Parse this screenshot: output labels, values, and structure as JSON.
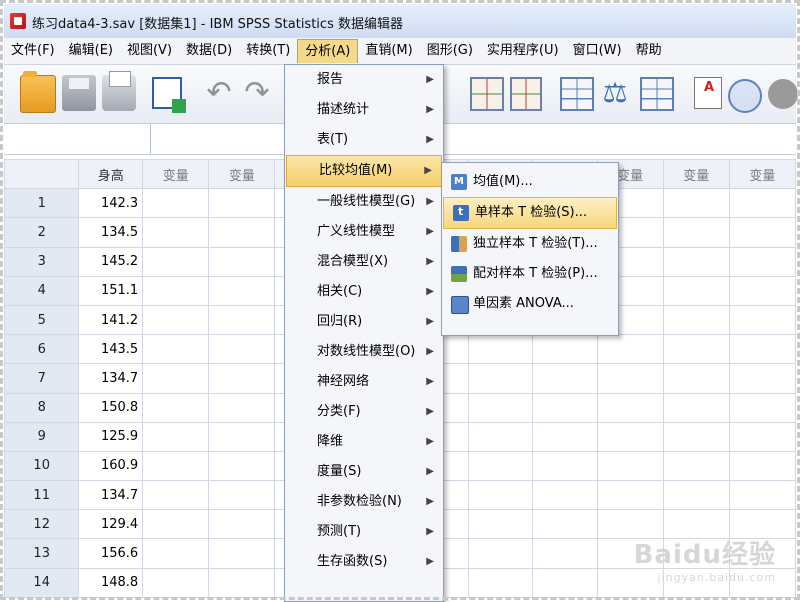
{
  "window": {
    "title": "练习data4-3.sav [数据集1] - IBM SPSS Statistics 数据编辑器"
  },
  "menubar": {
    "items": [
      {
        "label": "文件(F)"
      },
      {
        "label": "编辑(E)"
      },
      {
        "label": "视图(V)"
      },
      {
        "label": "数据(D)"
      },
      {
        "label": "转换(T)"
      },
      {
        "label": "分析(A)"
      },
      {
        "label": "直销(M)"
      },
      {
        "label": "图形(G)"
      },
      {
        "label": "实用程序(U)"
      },
      {
        "label": "窗口(W)"
      },
      {
        "label": "帮助"
      }
    ]
  },
  "toolbar": {
    "icons": [
      "open-folder-icon",
      "save-icon",
      "print-icon",
      "recall-dialog-icon",
      "undo-icon",
      "redo-icon",
      "goto-case-icon",
      "goto-variable-icon",
      "variables-icon",
      "weight-cases-icon",
      "split-file-icon",
      "value-labels-icon",
      "use-sets-icon",
      "show-all-variables-icon"
    ]
  },
  "grid": {
    "columns": [
      "身高",
      "变量",
      "变量",
      "",
      "",
      "",
      "",
      "",
      "变量",
      "变量",
      "变量"
    ],
    "rows": [
      {
        "num": "1",
        "height": "142.3"
      },
      {
        "num": "2",
        "height": "134.5"
      },
      {
        "num": "3",
        "height": "145.2"
      },
      {
        "num": "4",
        "height": "151.1"
      },
      {
        "num": "5",
        "height": "141.2"
      },
      {
        "num": "6",
        "height": "143.5"
      },
      {
        "num": "7",
        "height": "134.7"
      },
      {
        "num": "8",
        "height": "150.8"
      },
      {
        "num": "9",
        "height": "125.9"
      },
      {
        "num": "10",
        "height": "160.9"
      },
      {
        "num": "11",
        "height": "134.7"
      },
      {
        "num": "12",
        "height": "129.4"
      },
      {
        "num": "13",
        "height": "156.6"
      },
      {
        "num": "14",
        "height": "148.8"
      }
    ]
  },
  "analyze_menu": {
    "items": [
      {
        "label": "报告",
        "submenu": true
      },
      {
        "label": "描述统计",
        "submenu": true
      },
      {
        "label": "表(T)",
        "submenu": true
      },
      {
        "label": "比较均值(M)",
        "submenu": true,
        "highlighted": true
      },
      {
        "label": "一般线性模型(G)",
        "submenu": true
      },
      {
        "label": "广义线性模型",
        "submenu": true
      },
      {
        "label": "混合模型(X)",
        "submenu": true
      },
      {
        "label": "相关(C)",
        "submenu": true
      },
      {
        "label": "回归(R)",
        "submenu": true
      },
      {
        "label": "对数线性模型(O)",
        "submenu": true
      },
      {
        "label": "神经网络",
        "submenu": true
      },
      {
        "label": "分类(F)",
        "submenu": true
      },
      {
        "label": "降维",
        "submenu": true
      },
      {
        "label": "度量(S)",
        "submenu": true
      },
      {
        "label": "非参数检验(N)",
        "submenu": true
      },
      {
        "label": "预测(T)",
        "submenu": true
      },
      {
        "label": "生存函数(S)",
        "submenu": true
      }
    ]
  },
  "compare_means_menu": {
    "items": [
      {
        "label": "均值(M)...",
        "icon": "means-icon"
      },
      {
        "label": "单样本 T 检验(S)...",
        "icon": "one-sample-t-test-icon",
        "highlighted": true
      },
      {
        "label": "独立样本 T 检验(T)...",
        "icon": "independent-samples-t-test-icon"
      },
      {
        "label": "配对样本 T 检验(P)...",
        "icon": "paired-samples-t-test-icon"
      },
      {
        "label": "单因素 ANOVA...",
        "icon": "one-way-anova-icon"
      }
    ]
  },
  "watermark": {
    "brand": "Baidu经验",
    "url": "jingyan.baidu.com"
  }
}
